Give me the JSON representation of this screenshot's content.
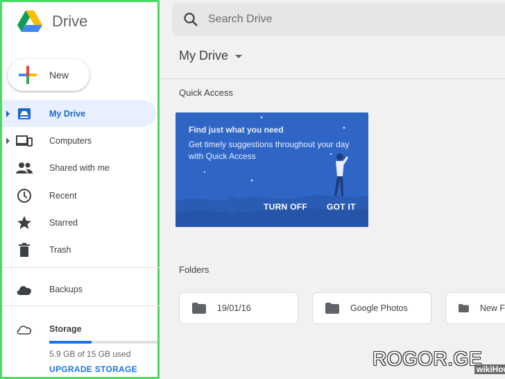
{
  "app": {
    "name": "Drive"
  },
  "sidebar": {
    "new_label": "New",
    "items": [
      {
        "label": "My Drive",
        "icon": "my-drive-icon",
        "active": true,
        "caret": true
      },
      {
        "label": "Computers",
        "icon": "computers-icon",
        "active": false,
        "caret": true
      },
      {
        "label": "Shared with me",
        "icon": "shared-icon",
        "active": false,
        "caret": false
      },
      {
        "label": "Recent",
        "icon": "clock-icon",
        "active": false,
        "caret": false
      },
      {
        "label": "Starred",
        "icon": "star-icon",
        "active": false,
        "caret": false
      },
      {
        "label": "Trash",
        "icon": "trash-icon",
        "active": false,
        "caret": false
      }
    ],
    "backups_label": "Backups",
    "storage": {
      "label": "Storage",
      "used_text": "5.9 GB of 15 GB used",
      "used_fraction": 0.39,
      "upgrade_label": "UPGRADE STORAGE"
    }
  },
  "search": {
    "placeholder": "Search Drive"
  },
  "main": {
    "title": "My Drive",
    "quick_access": {
      "label": "Quick Access",
      "card": {
        "headline": "Find just what you need",
        "body": "Get timely suggestions throughout your day with Quick Access",
        "turn_off_label": "TURN OFF",
        "got_it_label": "GOT IT"
      }
    },
    "folders": {
      "label": "Folders",
      "items": [
        "19/01/16",
        "Google Photos",
        "New F"
      ]
    }
  },
  "watermark": {
    "text": "ROGOR.GE",
    "badge": "wikiHow"
  },
  "colors": {
    "accent": "#1a73e8",
    "active_bg": "#e8f0fe",
    "card_bg": "#2f66c6",
    "frame": "#4cd964"
  }
}
